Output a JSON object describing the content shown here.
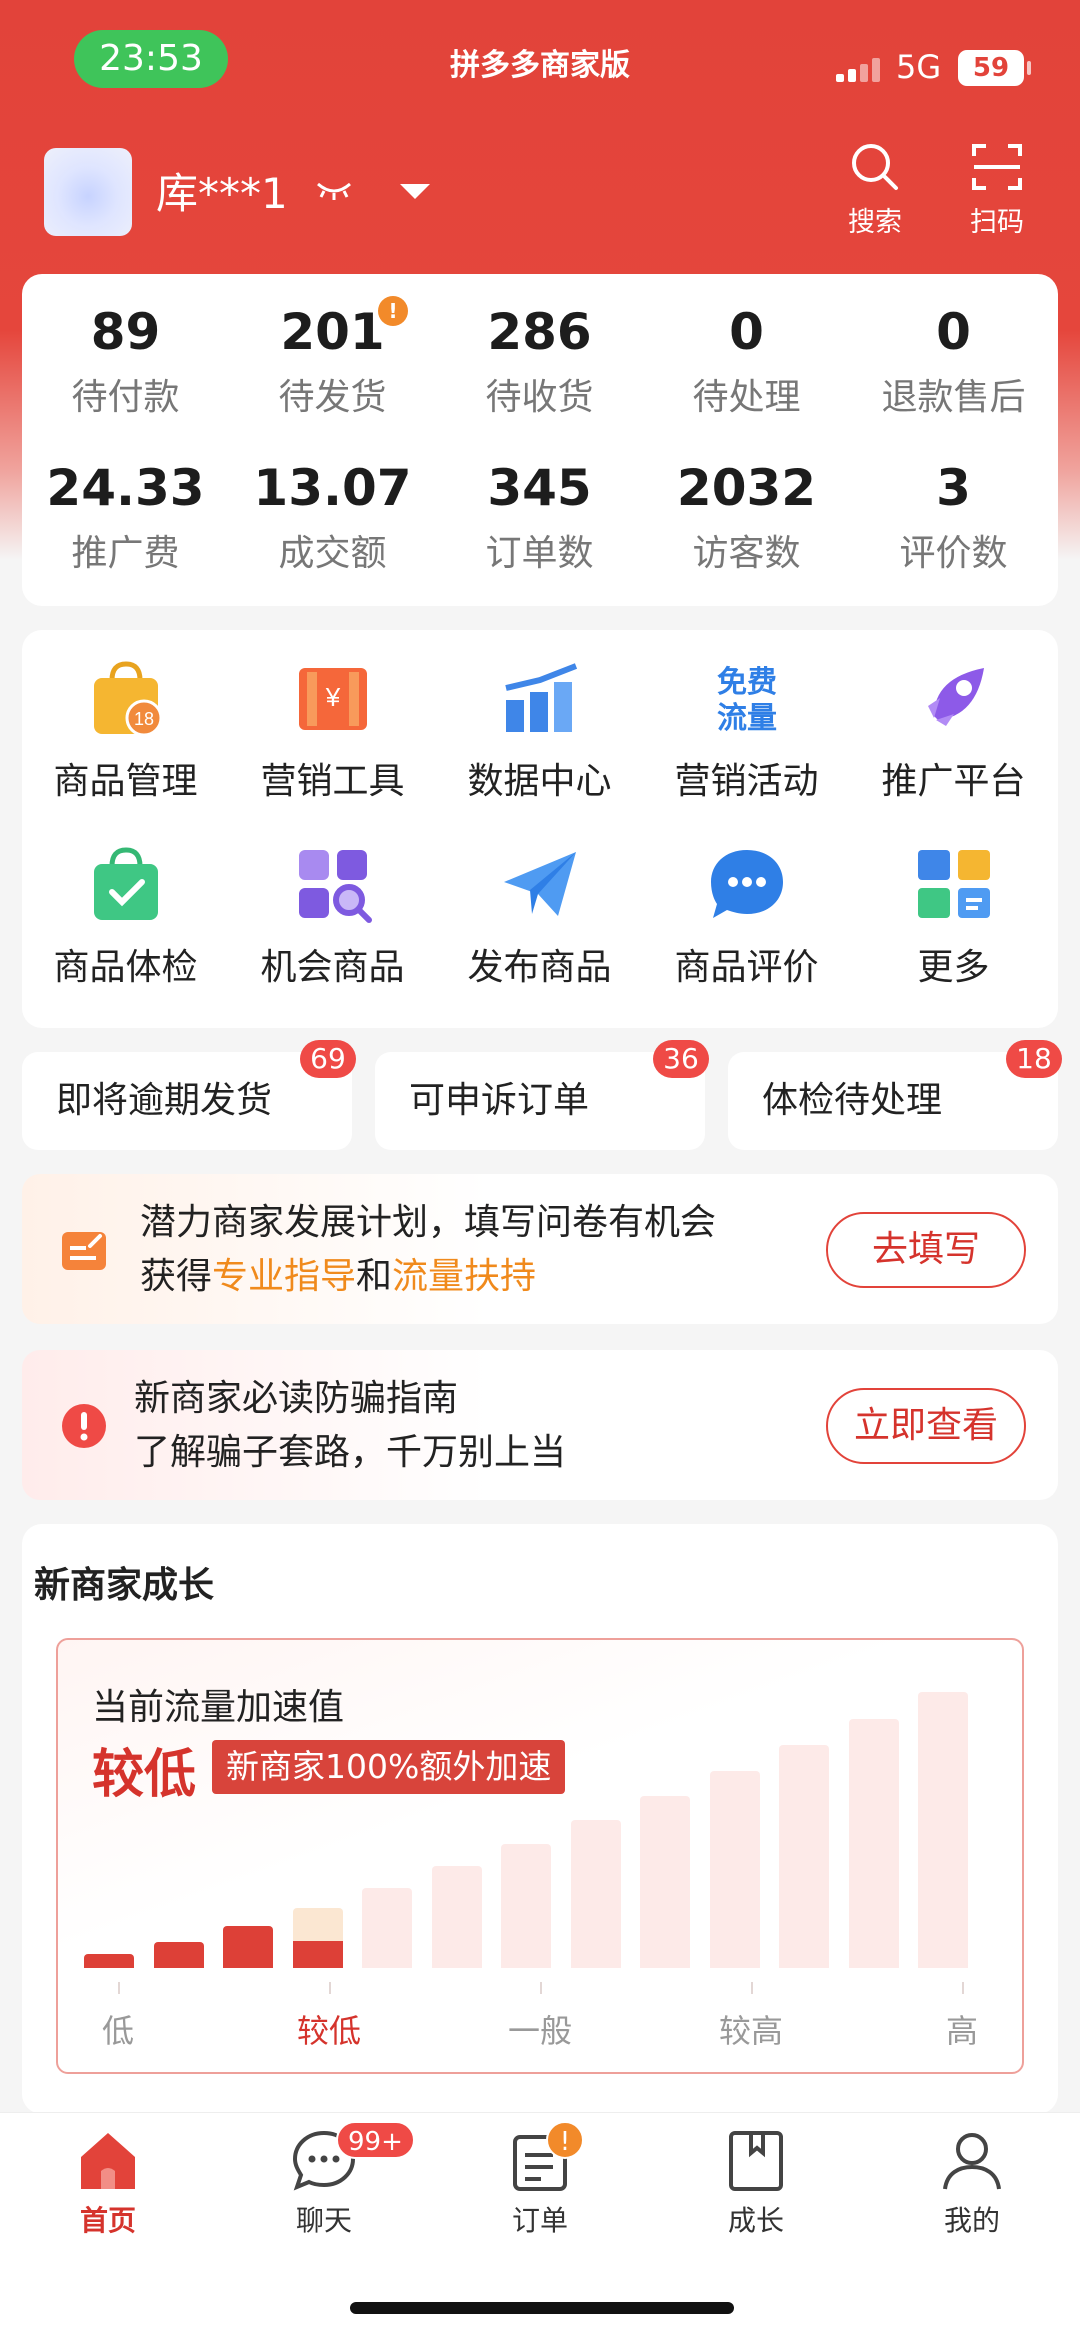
{
  "status_bar": {
    "time": "23:53",
    "app_title": "拼多多商家版",
    "network": "5G",
    "battery": "59"
  },
  "header": {
    "shop_name": "库***1",
    "search_label": "搜索",
    "scan_label": "扫码"
  },
  "order_stats": [
    {
      "value": "89",
      "label": "待付款"
    },
    {
      "value": "201",
      "label": "待发货",
      "alert": "!"
    },
    {
      "value": "286",
      "label": "待收货"
    },
    {
      "value": "0",
      "label": "待处理"
    },
    {
      "value": "0",
      "label": "退款售后"
    }
  ],
  "business_stats": [
    {
      "value": "24.33",
      "label": "推广费"
    },
    {
      "value": "13.07",
      "label": "成交额"
    },
    {
      "value": "345",
      "label": "订单数"
    },
    {
      "value": "2032",
      "label": "访客数"
    },
    {
      "value": "3",
      "label": "评价数"
    }
  ],
  "tools": [
    {
      "label": "商品管理",
      "icon": "shopping-bag-icon",
      "badge": "18"
    },
    {
      "label": "营销工具",
      "icon": "coupon-ticket-icon",
      "glyph": "¥"
    },
    {
      "label": "数据中心",
      "icon": "bar-chart-icon"
    },
    {
      "label": "营销活动",
      "icon": "free-traffic-icon",
      "glyph_line1": "免费",
      "glyph_line2": "流量"
    },
    {
      "label": "推广平台",
      "icon": "rocket-icon"
    },
    {
      "label": "商品体检",
      "icon": "checked-bag-icon"
    },
    {
      "label": "机会商品",
      "icon": "grid-search-icon"
    },
    {
      "label": "发布商品",
      "icon": "paper-plane-icon"
    },
    {
      "label": "商品评价",
      "icon": "chat-bubble-icon"
    },
    {
      "label": "更多",
      "icon": "more-apps-icon"
    }
  ],
  "task_chips": [
    {
      "label": "即将逾期发货",
      "count": "69"
    },
    {
      "label": "可申诉订单",
      "count": "36"
    },
    {
      "label": "体检待处理",
      "count": "18"
    }
  ],
  "banner_plan": {
    "line1": "潜力商家发展计划，填写问卷有机会",
    "line2_prefix": "获得",
    "highlight1": "专业指导",
    "line2_mid": "和",
    "highlight2": "流量扶持",
    "button": "去填写"
  },
  "banner_guide": {
    "line1": "新商家必读防骗指南",
    "line2": "了解骗子套路，千万别上当",
    "button": "立即查看"
  },
  "growth": {
    "title": "新商家成长",
    "speed_label": "当前流量加速值",
    "speed_value": "较低",
    "speed_tag": "新商家100%额外加速",
    "level_fraction": 0.27,
    "ticks": [
      "低",
      "较低",
      "一般",
      "较高",
      "高"
    ],
    "active_tick": 1,
    "colors": {
      "active": "#dd4037",
      "current_top": "#fbe7d2",
      "inactive": "#fdeae8"
    }
  },
  "tabbar": [
    {
      "label": "首页",
      "icon": "home-icon",
      "active": true
    },
    {
      "label": "聊天",
      "icon": "chat-icon",
      "badge": "99+"
    },
    {
      "label": "订单",
      "icon": "order-icon",
      "badge": "!"
    },
    {
      "label": "成长",
      "icon": "growth-book-icon"
    },
    {
      "label": "我的",
      "icon": "profile-icon"
    }
  ],
  "colors": {
    "brand": "#e2433a",
    "accent_orange": "#f08a1c",
    "badge": "#ef4a46"
  }
}
